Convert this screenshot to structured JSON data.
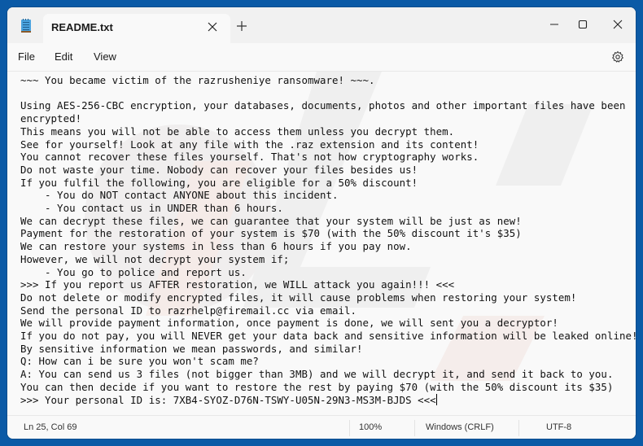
{
  "window": {
    "tab_title": "README.txt",
    "controls": {
      "minimize": "minimize",
      "maximize": "maximize",
      "close": "close"
    }
  },
  "menu": {
    "items": [
      "File",
      "Edit",
      "View"
    ]
  },
  "icons": {
    "app": "notepad-icon",
    "tab_close": "close-icon",
    "new_tab": "plus-icon",
    "settings": "gear-icon"
  },
  "document": {
    "lines": [
      "~~~ You became victim of the razrusheniye ransomware! ~~~.",
      "",
      "Using AES-256-CBC encryption, your databases, documents, photos and other important files have been",
      "encrypted!",
      "This means you will not be able to access them unless you decrypt them.",
      "See for yourself! Look at any file with the .raz extension and its content!",
      "You cannot recover these files yourself. That's not how cryptography works.",
      "Do not waste your time. Nobody can recover your files besides us!",
      "If you fulfil the following, you are eligible for a 50% discount!",
      "    - You do NOT contact ANYONE about this incident.",
      "    - You contact us in UNDER than 6 hours.",
      "We can decrypt these files, we can guarantee that your system will be just as new!",
      "Payment for the restoration of your system is $70 (with the 50% discount it's $35)",
      "We can restore your systems in less than 6 hours if you pay now.",
      "However, we will not decrypt your system if;",
      "    - You go to police and report us.",
      ">>> If you report us AFTER restoration, we WILL attack you again!!! <<<",
      "Do not delete or modify encrypted files, it will cause problems when restoring your system!",
      "Send the personal ID to razrhelp@firemail.cc via email.",
      "We will provide payment information, once payment is done, we will sent you a decryptor!",
      "If you do not pay, you will NEVER get your data back and sensitive information will be leaked online!",
      "By sensitive information we mean passwords, and similar!",
      "Q: How can i be sure you won't scam me?",
      "A: You can send us 3 files (not bigger than 3MB) and we will decrypt it, and send it back to you.",
      "You can then decide if you want to restore the rest by paying $70 (with the 50% discount its $35)",
      ">>> Your personal ID is: 7XB4-SYOZ-D76N-TSWY-U05N-29N3-MS3M-BJDS <<<"
    ]
  },
  "status": {
    "position": "Ln 25, Col 69",
    "zoom": "100%",
    "line_ending": "Windows (CRLF)",
    "encoding": "UTF-8"
  },
  "colors": {
    "desktop": "#0b5aa6",
    "titlebar": "#f1f1f1",
    "surface": "#f9f9f9"
  }
}
